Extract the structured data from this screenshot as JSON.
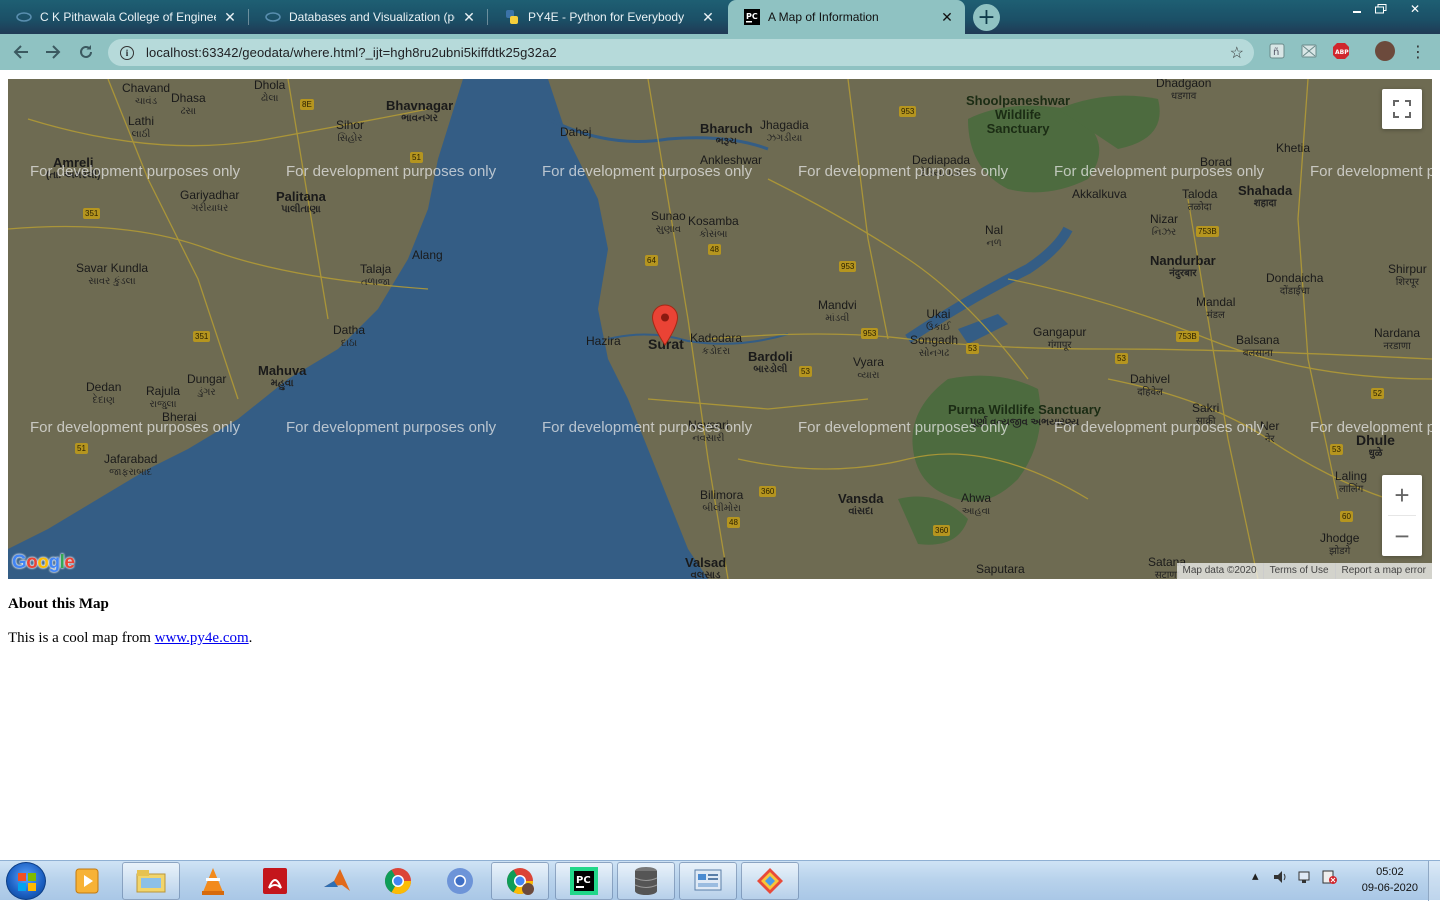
{
  "browser": {
    "tabs": [
      {
        "title": "C K Pithawala College of Enginee",
        "active": false
      },
      {
        "title": "Databases and Visualization (pee",
        "active": false
      },
      {
        "title": "PY4E - Python for Everybody",
        "active": false
      },
      {
        "title": "A Map of Information",
        "active": true
      }
    ],
    "address": "localhost:63342/geodata/where.html?_ijt=hgh8ru2ubni5kiffdtk25g32a2",
    "extensions": [
      "extension-icon",
      "extension-icon",
      "ABP"
    ],
    "accent": "#8fc2c2"
  },
  "map": {
    "watermark": "For development purposes only",
    "logo": "Google",
    "attribution": [
      "Map data ©2020",
      "Terms of Use",
      "Report a map error"
    ],
    "marker_label": "Surat",
    "places": [
      {
        "name": "Chavand",
        "sub": "ચાવંડ"
      },
      {
        "name": "Dhasa",
        "sub": "ઢસા"
      },
      {
        "name": "Dhola",
        "sub": "ઢોલા"
      },
      {
        "name": "Bhavnagar",
        "sub": "ભાવનગર"
      },
      {
        "name": "Lathi",
        "sub": "લાઠી"
      },
      {
        "name": "Sihor",
        "sub": "સિહોર"
      },
      {
        "name": "Amreli",
        "sub": "(તા. અમરેલી)"
      },
      {
        "name": "Gariyadhar",
        "sub": "ગરીયાધર"
      },
      {
        "name": "Palitana",
        "sub": "પાલીતાણા"
      },
      {
        "name": "Savar Kundla",
        "sub": "સાવર કુંડલા"
      },
      {
        "name": "Talaja",
        "sub": "તળાજા"
      },
      {
        "name": "Alang",
        "sub": ""
      },
      {
        "name": "Datha",
        "sub": "દાઠા"
      },
      {
        "name": "Mahuva",
        "sub": "મહુવા"
      },
      {
        "name": "Dedan",
        "sub": "દેદાણ"
      },
      {
        "name": "Rajula",
        "sub": "રાજુલા"
      },
      {
        "name": "Dungar",
        "sub": "ડુંગર"
      },
      {
        "name": "Bherai",
        "sub": ""
      },
      {
        "name": "Jafarabad",
        "sub": "જાફરાબાદ"
      },
      {
        "name": "Dahej",
        "sub": ""
      },
      {
        "name": "Bharuch",
        "sub": "ભરૂચ"
      },
      {
        "name": "Jhagadia",
        "sub": "ઝગડીયા"
      },
      {
        "name": "Ankleshwar",
        "sub": ""
      },
      {
        "name": "Sunao",
        "sub": "સુણાવ"
      },
      {
        "name": "Kosamba",
        "sub": "કોસંબા"
      },
      {
        "name": "Hazira",
        "sub": ""
      },
      {
        "name": "Surat",
        "sub": ""
      },
      {
        "name": "Kadodara",
        "sub": "કડોદરા"
      },
      {
        "name": "Bardoli",
        "sub": "બારડોલી"
      },
      {
        "name": "Mandvi",
        "sub": "માંડવી"
      },
      {
        "name": "Vyara",
        "sub": "વ્યારા"
      },
      {
        "name": "Ukai",
        "sub": "ઉકાઈ"
      },
      {
        "name": "Songadh",
        "sub": "સોનગઢ"
      },
      {
        "name": "Navsari",
        "sub": "નવસારી"
      },
      {
        "name": "Bilimora",
        "sub": "બીલીમોરા"
      },
      {
        "name": "Vansda",
        "sub": "વાંસદા"
      },
      {
        "name": "Ahwa",
        "sub": "આહવા"
      },
      {
        "name": "Valsad",
        "sub": "વલસાડ"
      },
      {
        "name": "Saputara",
        "sub": ""
      },
      {
        "name": "Shoolpaneshwar Wildlife Sanctuary",
        "sub": ""
      },
      {
        "name": "Dediapada",
        "sub": "દેડિયાપાડા"
      },
      {
        "name": "Akkalkuva",
        "sub": ""
      },
      {
        "name": "Nal",
        "sub": "નળ"
      },
      {
        "name": "Nizar",
        "sub": "નિઝર"
      },
      {
        "name": "Khetia",
        "sub": ""
      },
      {
        "name": "Borad",
        "sub": ""
      },
      {
        "name": "Taloda",
        "sub": "तळोदा"
      },
      {
        "name": "Shahada",
        "sub": "शहादा"
      },
      {
        "name": "Nandurbar",
        "sub": "नंदुरबार"
      },
      {
        "name": "Dondaicha",
        "sub": "दोंडाईचा"
      },
      {
        "name": "Shirpur",
        "sub": "शिरपूर"
      },
      {
        "name": "Mandal",
        "sub": "मंडल"
      },
      {
        "name": "Gangapur",
        "sub": "गंगापूर"
      },
      {
        "name": "Balsana",
        "sub": "बलसाना"
      },
      {
        "name": "Nardana",
        "sub": "नरडाणा"
      },
      {
        "name": "Dahivel",
        "sub": "दहिवेल"
      },
      {
        "name": "Sakri",
        "sub": "साक्री"
      },
      {
        "name": "Purna Wildlife Sanctuary",
        "sub": "પૂર્ણા વન્યજીવ અભયારણ્ય"
      },
      {
        "name": "Ner",
        "sub": "नेर"
      },
      {
        "name": "Dhule",
        "sub": "धुळे"
      },
      {
        "name": "Laling",
        "sub": "लालिंग"
      },
      {
        "name": "Jhodge",
        "sub": "झोडगे"
      },
      {
        "name": "Satana",
        "sub": "सटाणा"
      },
      {
        "name": "Dhadgaon",
        "sub": "धडगाव"
      }
    ],
    "roads": [
      "8E",
      "51",
      "351",
      "351",
      "51",
      "64",
      "48",
      "953",
      "953",
      "953",
      "53",
      "53",
      "753B",
      "753B",
      "53",
      "52",
      "53",
      "360",
      "48",
      "360",
      "60"
    ]
  },
  "about": {
    "title": "About this Map",
    "text_before": "This is a cool map from ",
    "link": "www.py4e.com",
    "text_after": "."
  },
  "taskbar": {
    "time": "05:02",
    "date": "09-06-2020",
    "apps": [
      "media-player-icon",
      "file-explorer-icon",
      "vlc-icon",
      "acrobat-icon",
      "matlab-icon",
      "chrome-icon",
      "chromium-icon",
      "chrome-profile-icon",
      "pycharm-icon",
      "database-icon",
      "control-panel-icon",
      "app-icon"
    ]
  }
}
